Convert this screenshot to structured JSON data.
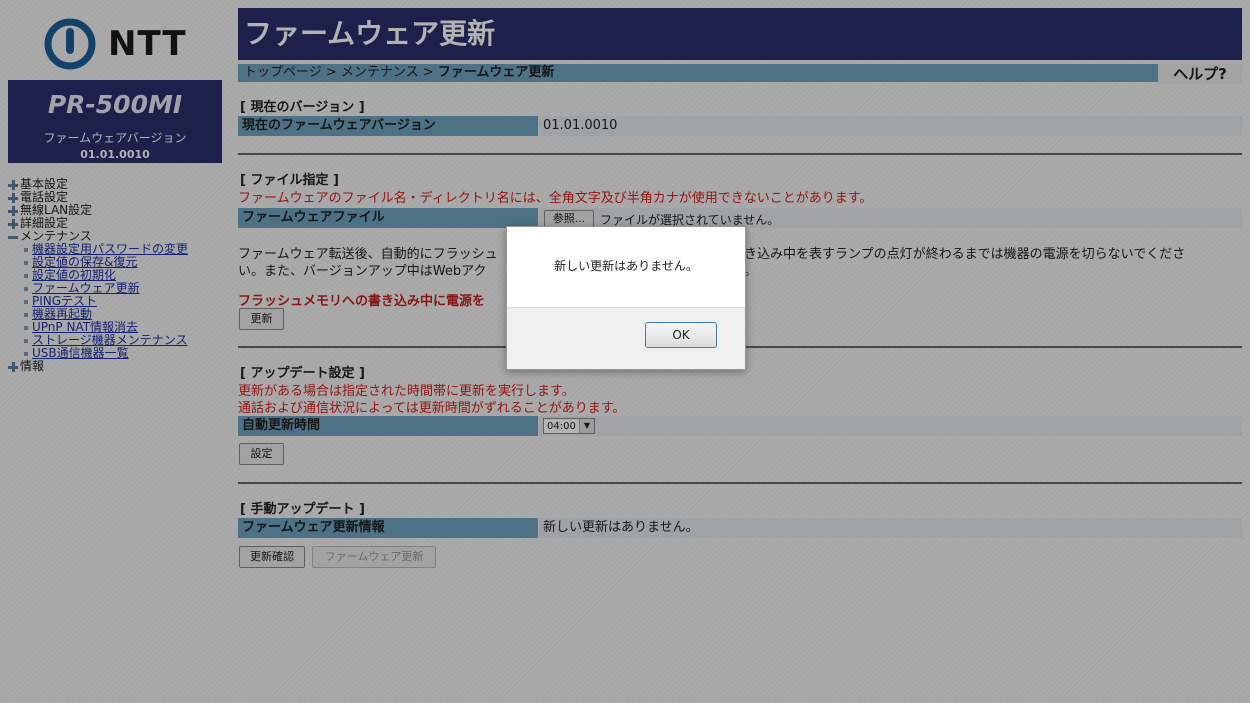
{
  "brand": {
    "logo_text": "NTT"
  },
  "device": {
    "model": "PR-500MI",
    "fw_label": "ファームウェアバージョン",
    "fw_version": "01.01.0010"
  },
  "nav": {
    "items": [
      {
        "label": "基本設定",
        "expanded": false
      },
      {
        "label": "電話設定",
        "expanded": false
      },
      {
        "label": "無線LAN設定",
        "expanded": false
      },
      {
        "label": "詳細設定",
        "expanded": false
      },
      {
        "label": "メンテナンス",
        "expanded": true
      }
    ],
    "maintenance": [
      "機器設定用パスワードの変更",
      "設定値の保存&復元",
      "設定値の初期化",
      "ファームウェア更新",
      "PINGテスト",
      "機器再起動",
      "UPnP NAT情報消去",
      "ストレージ機器メンテナンス",
      "USB通信機器一覧"
    ],
    "last": "情報"
  },
  "page": {
    "title": "ファームウェア更新",
    "breadcrumb_1": "トップページ >",
    "breadcrumb_2": "メンテナンス >",
    "breadcrumb_3": "ファームウェア更新",
    "help": "ヘルプ?"
  },
  "current": {
    "title": "[ 現在のバージョン ]",
    "label": "現在のファームウェアバージョン",
    "value": "01.01.0010"
  },
  "file": {
    "title": "[ ファイル指定 ]",
    "warning": "ファームウェアのファイル名・ディレクトリ名には、全角文字及び半角カナが使用できないことがあります。",
    "label": "ファームウェアファイル",
    "browse": "参照...",
    "no_file": "ファイルが選択されていません。",
    "note_1": "ファームウェア転送後、自動的にフラッシュ",
    "note_1b": "き込み中を表すランプの点灯が終わるまでは機器の電源を切らないでくださ",
    "note_2": "い。また、バージョンアップ中はWebアク",
    "note_2b": "。",
    "alert": "フラッシュメモリへの書き込み中に電源を",
    "button": "更新"
  },
  "auto": {
    "title": "[ アップデート設定 ]",
    "note_1": "更新がある場合は指定された時間帯に更新を実行します。",
    "note_2": "通話および通信状況によっては更新時間がずれることがあります。",
    "label": "自動更新時間",
    "time": "04:00",
    "button": "設定"
  },
  "manual": {
    "title": "[ 手動アップデート ]",
    "label": "ファームウェア更新情報",
    "value": "新しい更新はありません。",
    "check_button": "更新確認",
    "update_button": "ファームウェア更新"
  },
  "dialog": {
    "message": "新しい更新はありません。",
    "ok": "OK"
  },
  "colors": {
    "header": "#2b2e6e",
    "label_bg": "#6fa3bf",
    "alert": "#d42020"
  }
}
